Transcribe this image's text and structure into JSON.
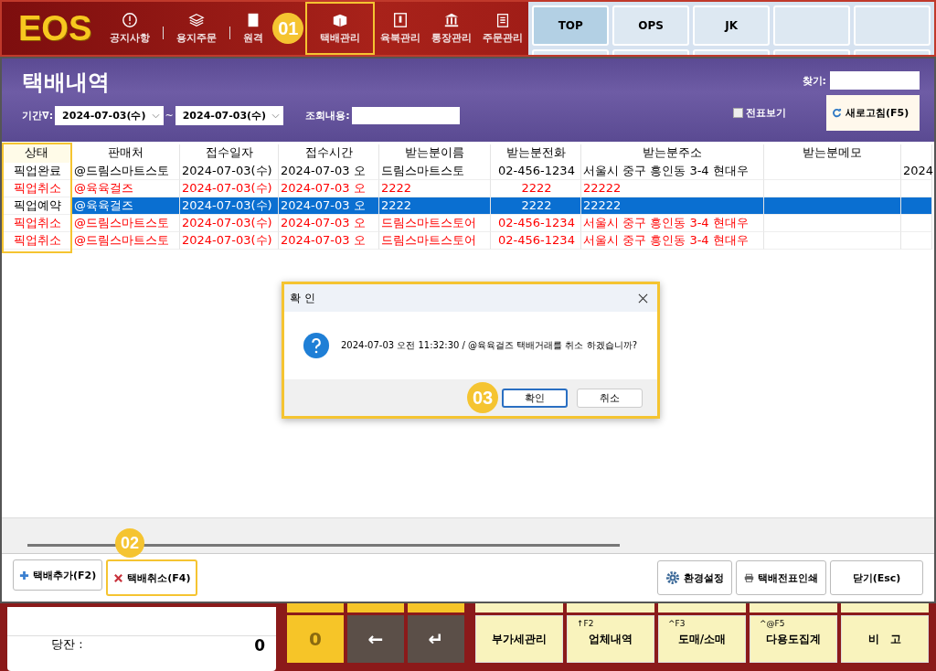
{
  "app": {
    "logo": "EOS"
  },
  "nav": [
    {
      "label": "공지사항",
      "highlighted": false
    },
    {
      "label": "용지주문",
      "highlighted": false
    },
    {
      "label": "원격",
      "highlighted": false
    },
    {
      "label": "택배관리",
      "highlighted": true,
      "callout": "01"
    },
    {
      "label": "육북관리",
      "highlighted": false
    },
    {
      "label": "통장관리",
      "highlighted": false
    },
    {
      "label": "주문관리",
      "highlighted": false
    }
  ],
  "quick_buttons": [
    {
      "label": "TOP",
      "selected": true
    },
    {
      "label": "OPS",
      "selected": false
    },
    {
      "label": "JK",
      "selected": false
    },
    {
      "selected": false
    },
    {
      "selected": false
    }
  ],
  "window": {
    "title": "택배내역"
  },
  "filters": {
    "period_label": "기간∇:",
    "date_from": "2024-07-03(수)",
    "separator": "~",
    "date_to": "2024-07-03(수)",
    "query_label": "조회내용:",
    "find_label": "찾기:",
    "slip_view": {
      "label": "전표보기",
      "checked": false
    },
    "refresh": "새로고침(F5)"
  },
  "table": {
    "columns": [
      {
        "label": "상태",
        "highlighted": true
      },
      {
        "label": "판매처",
        "highlighted": false
      },
      {
        "label": "접수일자",
        "highlighted": false
      },
      {
        "label": "접수시간",
        "highlighted": false
      },
      {
        "label": "받는분이름",
        "highlighted": false
      },
      {
        "label": "받는분전화",
        "highlighted": false
      },
      {
        "label": "받는분주소",
        "highlighted": false
      },
      {
        "label": "받는분메모",
        "highlighted": false
      },
      {
        "highlighted": false
      }
    ],
    "rows": [
      {
        "color": "#000000",
        "selected": false,
        "cells": [
          "픽업완료",
          "@드림스마트스토",
          "2024-07-03(수)",
          "2024-07-03 오",
          "드림스마트스토",
          "02-456-1234",
          "서울시 중구 흥인동 3-4 현대우",
          null,
          "2024"
        ]
      },
      {
        "color": "#ff0000",
        "selected": false,
        "cells": [
          "픽업취소",
          "@육육걸즈",
          "2024-07-03(수)",
          "2024-07-03 오",
          "2222",
          "2222",
          "22222",
          null,
          null
        ]
      },
      {
        "color": "#000000",
        "selected": true,
        "cells": [
          "픽업예약",
          "@육육걸즈",
          "2024-07-03(수)",
          "2024-07-03 오",
          "2222",
          "2222",
          "22222",
          null,
          null
        ]
      },
      {
        "color": "#ff0000",
        "selected": false,
        "cells": [
          "픽업취소",
          "@드림스마트스토",
          "2024-07-03(수)",
          "2024-07-03 오",
          "드림스마트스토어",
          "02-456-1234",
          "서울시 중구 흥인동 3-4 현대우",
          null,
          null
        ]
      },
      {
        "color": "#ff0000",
        "selected": false,
        "cells": [
          "픽업취소",
          "@드림스마트스토",
          "2024-07-03(수)",
          "2024-07-03 오",
          "드림스마트스토어",
          "02-456-1234",
          "서울시 중구 흥인동 3-4 현대우",
          null,
          null
        ]
      }
    ]
  },
  "actions_left": [
    {
      "label": "택배추가(F2)",
      "highlighted": false
    },
    {
      "label": "택배취소(F4)",
      "highlighted": true,
      "callout": "02"
    }
  ],
  "actions_right": [
    "환경설정",
    "택배전표인쇄",
    "닫기(Esc)"
  ],
  "dialog": {
    "title": "확 인",
    "message": "2024-07-03 오전 11:32:30 / @육육걸즈 택배거래를 취소 하겠습니까?",
    "buttons": [
      {
        "label": "확인",
        "focused": true,
        "callout": "03"
      },
      {
        "label": "취소",
        "focused": false
      }
    ],
    "highlighted": true
  },
  "footer": {
    "balance_label": "당잔 :",
    "balance_value": "0",
    "keypad": [
      "0",
      "←",
      "↵"
    ],
    "function_keys": [
      {
        "label": "부가세관리"
      },
      {
        "label": "업체내역",
        "hint": "↑F2"
      },
      {
        "label": "도매/소매",
        "hint": "^F3"
      },
      {
        "label": "다용도집계",
        "hint": "^@F5"
      },
      {
        "label": "비　고"
      }
    ]
  }
}
